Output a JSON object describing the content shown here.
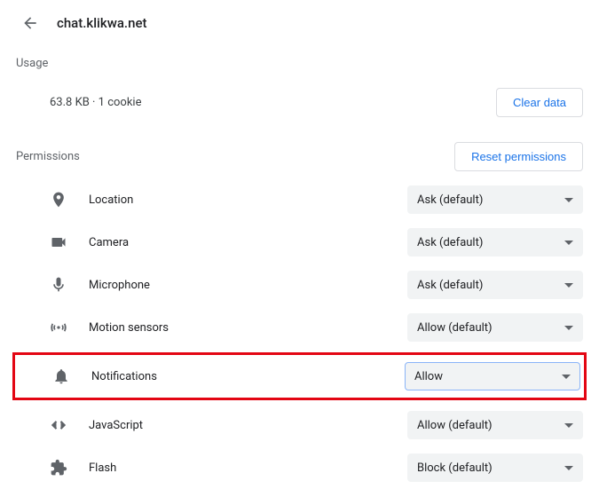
{
  "header": {
    "site_name": "chat.klikwa.net"
  },
  "usage": {
    "section_label": "Usage",
    "text": "63.8 KB · 1 cookie",
    "clear_button": "Clear data"
  },
  "permissions": {
    "section_label": "Permissions",
    "reset_button": "Reset permissions",
    "rows": [
      {
        "label": "Location",
        "value": "Ask (default)"
      },
      {
        "label": "Camera",
        "value": "Ask (default)"
      },
      {
        "label": "Microphone",
        "value": "Ask (default)"
      },
      {
        "label": "Motion sensors",
        "value": "Allow (default)"
      },
      {
        "label": "Notifications",
        "value": "Allow"
      },
      {
        "label": "JavaScript",
        "value": "Allow (default)"
      },
      {
        "label": "Flash",
        "value": "Block (default)"
      }
    ]
  }
}
